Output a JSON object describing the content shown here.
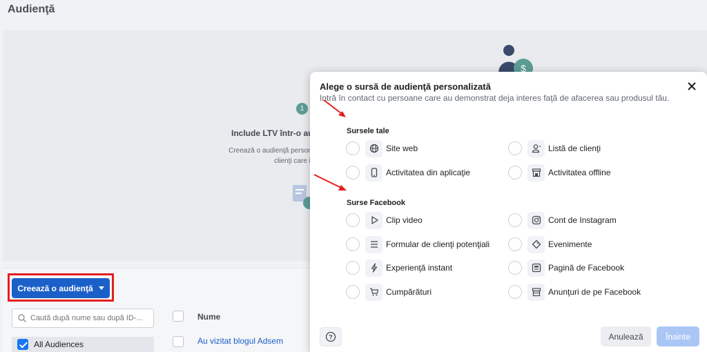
{
  "page": {
    "title": "Audienţă"
  },
  "background": {
    "step": "1",
    "heading": "Include LTV într-o audienţă",
    "text_line1": "Creează o audienţă personalizată",
    "text_line2": "clienţi care iau"
  },
  "toolbar": {
    "create_label": "Creează o audienţă"
  },
  "search": {
    "placeholder": "Caută după nume sau după ID-..."
  },
  "filters": {
    "all_audiences": "All Audiences"
  },
  "table": {
    "column_name": "Nume",
    "rows": [
      {
        "name": "Au vizitat blogul Adsem"
      }
    ]
  },
  "modal": {
    "title": "Alege o sursă de audienţă personalizată",
    "subtitle": "Intră în contact cu persoane care au demonstrat deja interes faţă de afacerea sau produsul tău.",
    "sections": [
      {
        "label": "Sursele tale",
        "options": [
          {
            "label": "Site web",
            "icon": "globe-icon"
          },
          {
            "label": "Listă de clienţi",
            "icon": "customer-list-icon"
          },
          {
            "label": "Activitatea din aplicaţie",
            "icon": "mobile-app-icon"
          },
          {
            "label": "Activitatea offline",
            "icon": "offline-store-icon"
          }
        ]
      },
      {
        "label": "Surse Facebook",
        "options": [
          {
            "label": "Clip video",
            "icon": "play-icon"
          },
          {
            "label": "Cont de Instagram",
            "icon": "instagram-icon"
          },
          {
            "label": "Formular de clienţi potenţiali",
            "icon": "form-lines-icon"
          },
          {
            "label": "Evenimente",
            "icon": "tag-icon"
          },
          {
            "label": "Experienţă instant",
            "icon": "lightning-icon"
          },
          {
            "label": "Pagină de Facebook",
            "icon": "facebook-page-icon"
          },
          {
            "label": "Cumpărături",
            "icon": "shopping-cart-icon"
          },
          {
            "label": "Anunţuri de pe Facebook",
            "icon": "marketplace-icon"
          }
        ]
      }
    ],
    "cancel_label": "Anulează",
    "next_label": "Înainte"
  },
  "colors": {
    "primary": "#1b5fc9",
    "annotation": "#e41e1e",
    "disabled_next": "#a9c6f5"
  }
}
